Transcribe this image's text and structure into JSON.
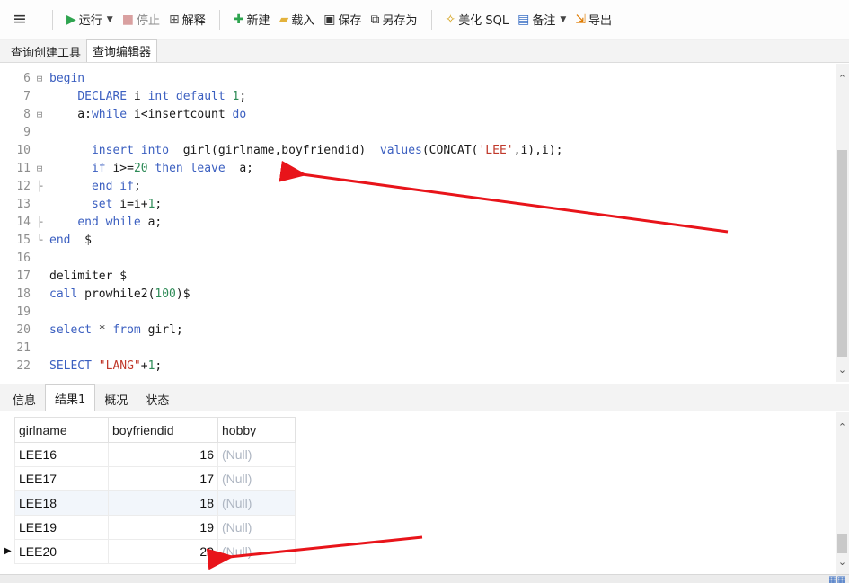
{
  "toolbar": {
    "menu_glyph": "≡",
    "run_label": "运行",
    "stop_label": "停止",
    "explain_label": "解释",
    "new_label": "新建",
    "load_label": "载入",
    "save_label": "保存",
    "saveas_label": "另存为",
    "beautify_label": "美化 SQL",
    "notes_label": "备注",
    "export_label": "导出"
  },
  "query_tabs": [
    "查询创建工具",
    "查询编辑器"
  ],
  "editor": {
    "lines": [
      {
        "n": "6",
        "fold": "⊟",
        "tokens": [
          [
            "kw",
            "begin"
          ]
        ]
      },
      {
        "n": "7",
        "fold": "",
        "tokens": [
          [
            "txt",
            "    "
          ],
          [
            "kw",
            "DECLARE"
          ],
          [
            "txt",
            " i "
          ],
          [
            "kw",
            "int"
          ],
          [
            "txt",
            " "
          ],
          [
            "kw",
            "default"
          ],
          [
            "txt",
            " "
          ],
          [
            "num",
            "1"
          ],
          [
            "txt",
            ";"
          ]
        ]
      },
      {
        "n": "8",
        "fold": "⊟",
        "tokens": [
          [
            "txt",
            "    a:"
          ],
          [
            "kw",
            "while"
          ],
          [
            "txt",
            " i<insertcount "
          ],
          [
            "kw",
            "do"
          ]
        ]
      },
      {
        "n": "9",
        "fold": "",
        "tokens": []
      },
      {
        "n": "10",
        "fold": "",
        "tokens": [
          [
            "txt",
            "      "
          ],
          [
            "kw",
            "insert"
          ],
          [
            "txt",
            " "
          ],
          [
            "kw",
            "into"
          ],
          [
            "txt",
            "  girl(girlname,boyfriendid)  "
          ],
          [
            "kw",
            "values"
          ],
          [
            "txt",
            "(CONCAT("
          ],
          [
            "str",
            "'LEE'"
          ],
          [
            "txt",
            ",i),i);"
          ]
        ]
      },
      {
        "n": "11",
        "fold": "⊟",
        "tokens": [
          [
            "txt",
            "      "
          ],
          [
            "kw",
            "if"
          ],
          [
            "txt",
            " i>="
          ],
          [
            "num",
            "20"
          ],
          [
            "txt",
            " "
          ],
          [
            "kw",
            "then"
          ],
          [
            "txt",
            " "
          ],
          [
            "kw",
            "leave"
          ],
          [
            "txt",
            "  a;"
          ]
        ]
      },
      {
        "n": "12",
        "fold": "├",
        "tokens": [
          [
            "txt",
            "      "
          ],
          [
            "kw",
            "end"
          ],
          [
            "txt",
            " "
          ],
          [
            "kw",
            "if"
          ],
          [
            "txt",
            ";"
          ]
        ]
      },
      {
        "n": "13",
        "fold": "",
        "tokens": [
          [
            "txt",
            "      "
          ],
          [
            "kw",
            "set"
          ],
          [
            "txt",
            " i=i+"
          ],
          [
            "num",
            "1"
          ],
          [
            "txt",
            ";"
          ]
        ]
      },
      {
        "n": "14",
        "fold": "├",
        "tokens": [
          [
            "txt",
            "    "
          ],
          [
            "kw",
            "end"
          ],
          [
            "txt",
            " "
          ],
          [
            "kw",
            "while"
          ],
          [
            "txt",
            " a;"
          ]
        ]
      },
      {
        "n": "15",
        "fold": "└",
        "tokens": [
          [
            "kw",
            "end"
          ],
          [
            "txt",
            "  $"
          ]
        ]
      },
      {
        "n": "16",
        "fold": "",
        "tokens": []
      },
      {
        "n": "17",
        "fold": "",
        "tokens": [
          [
            "txt",
            "delimiter $"
          ]
        ]
      },
      {
        "n": "18",
        "fold": "",
        "tokens": [
          [
            "kw",
            "call"
          ],
          [
            "txt",
            " prowhile2("
          ],
          [
            "num",
            "100"
          ],
          [
            "txt",
            ")$"
          ]
        ]
      },
      {
        "n": "19",
        "fold": "",
        "tokens": []
      },
      {
        "n": "20",
        "fold": "",
        "tokens": [
          [
            "kw",
            "select"
          ],
          [
            "txt",
            " * "
          ],
          [
            "kw",
            "from"
          ],
          [
            "txt",
            " girl;"
          ]
        ]
      },
      {
        "n": "21",
        "fold": "",
        "tokens": []
      },
      {
        "n": "22",
        "fold": "",
        "tokens": [
          [
            "kw",
            "SELECT"
          ],
          [
            "txt",
            " "
          ],
          [
            "str",
            "\"LANG\""
          ],
          [
            "txt",
            "+"
          ],
          [
            "num",
            "1"
          ],
          [
            "txt",
            ";"
          ]
        ]
      }
    ]
  },
  "result_tabs": [
    "信息",
    "结果1",
    "概况",
    "状态"
  ],
  "grid": {
    "headers": [
      "girlname",
      "boyfriendid",
      "hobby"
    ],
    "rows": [
      [
        "LEE16",
        "16",
        "(Null)"
      ],
      [
        "LEE17",
        "17",
        "(Null)"
      ],
      [
        "LEE18",
        "18",
        "(Null)"
      ],
      [
        "LEE19",
        "19",
        "(Null)"
      ],
      [
        "LEE20",
        "20",
        "(Null)"
      ]
    ]
  },
  "colors": {
    "keyword": "#3b5fc0",
    "number": "#2e8b57",
    "string": "#c0392b",
    "annotation_arrow": "#e8141a"
  }
}
